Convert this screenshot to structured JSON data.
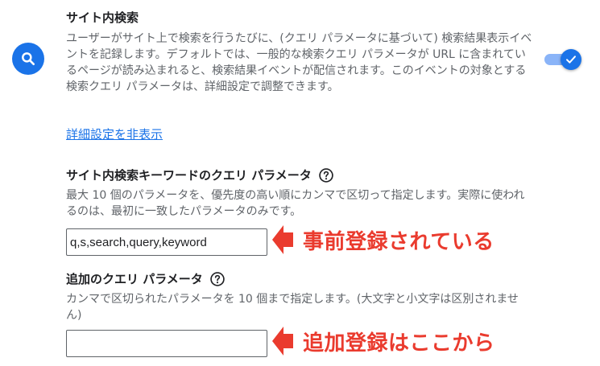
{
  "site_search": {
    "title": "サイト内検索",
    "description": "ユーザーがサイト上で検索を行うたびに、(クエリ パラメータに基づいて) 検索結果表示イベントを記録します。デフォルトでは、一般的な検索クエリ パラメータが URL に含まれているページが読み込まれると、検索結果イベントが配信されます。このイベントの対象とする検索クエリ パラメータは、詳細設定で調整できます。",
    "enabled": true,
    "icon": "search-icon"
  },
  "advanced_link": "詳細設定を非表示",
  "keyword_param": {
    "label": "サイト内検索キーワードのクエリ パラメータ",
    "help": "最大 10 個のパラメータを、優先度の高い順にカンマで区切って指定します。実際に使われるのは、最初に一致したパラメータのみです。",
    "value": "q,s,search,query,keyword"
  },
  "additional_param": {
    "label": "追加のクエリ パラメータ",
    "help": "カンマで区切られたパラメータを 10 個まで指定します。(大文字と小文字は区別されません)",
    "value": ""
  },
  "annotations": {
    "registered": "事前登録されている",
    "add_here": "追加登録はここから"
  },
  "colors": {
    "accent": "#1a73e8",
    "annotation": "#ea3b2e"
  }
}
